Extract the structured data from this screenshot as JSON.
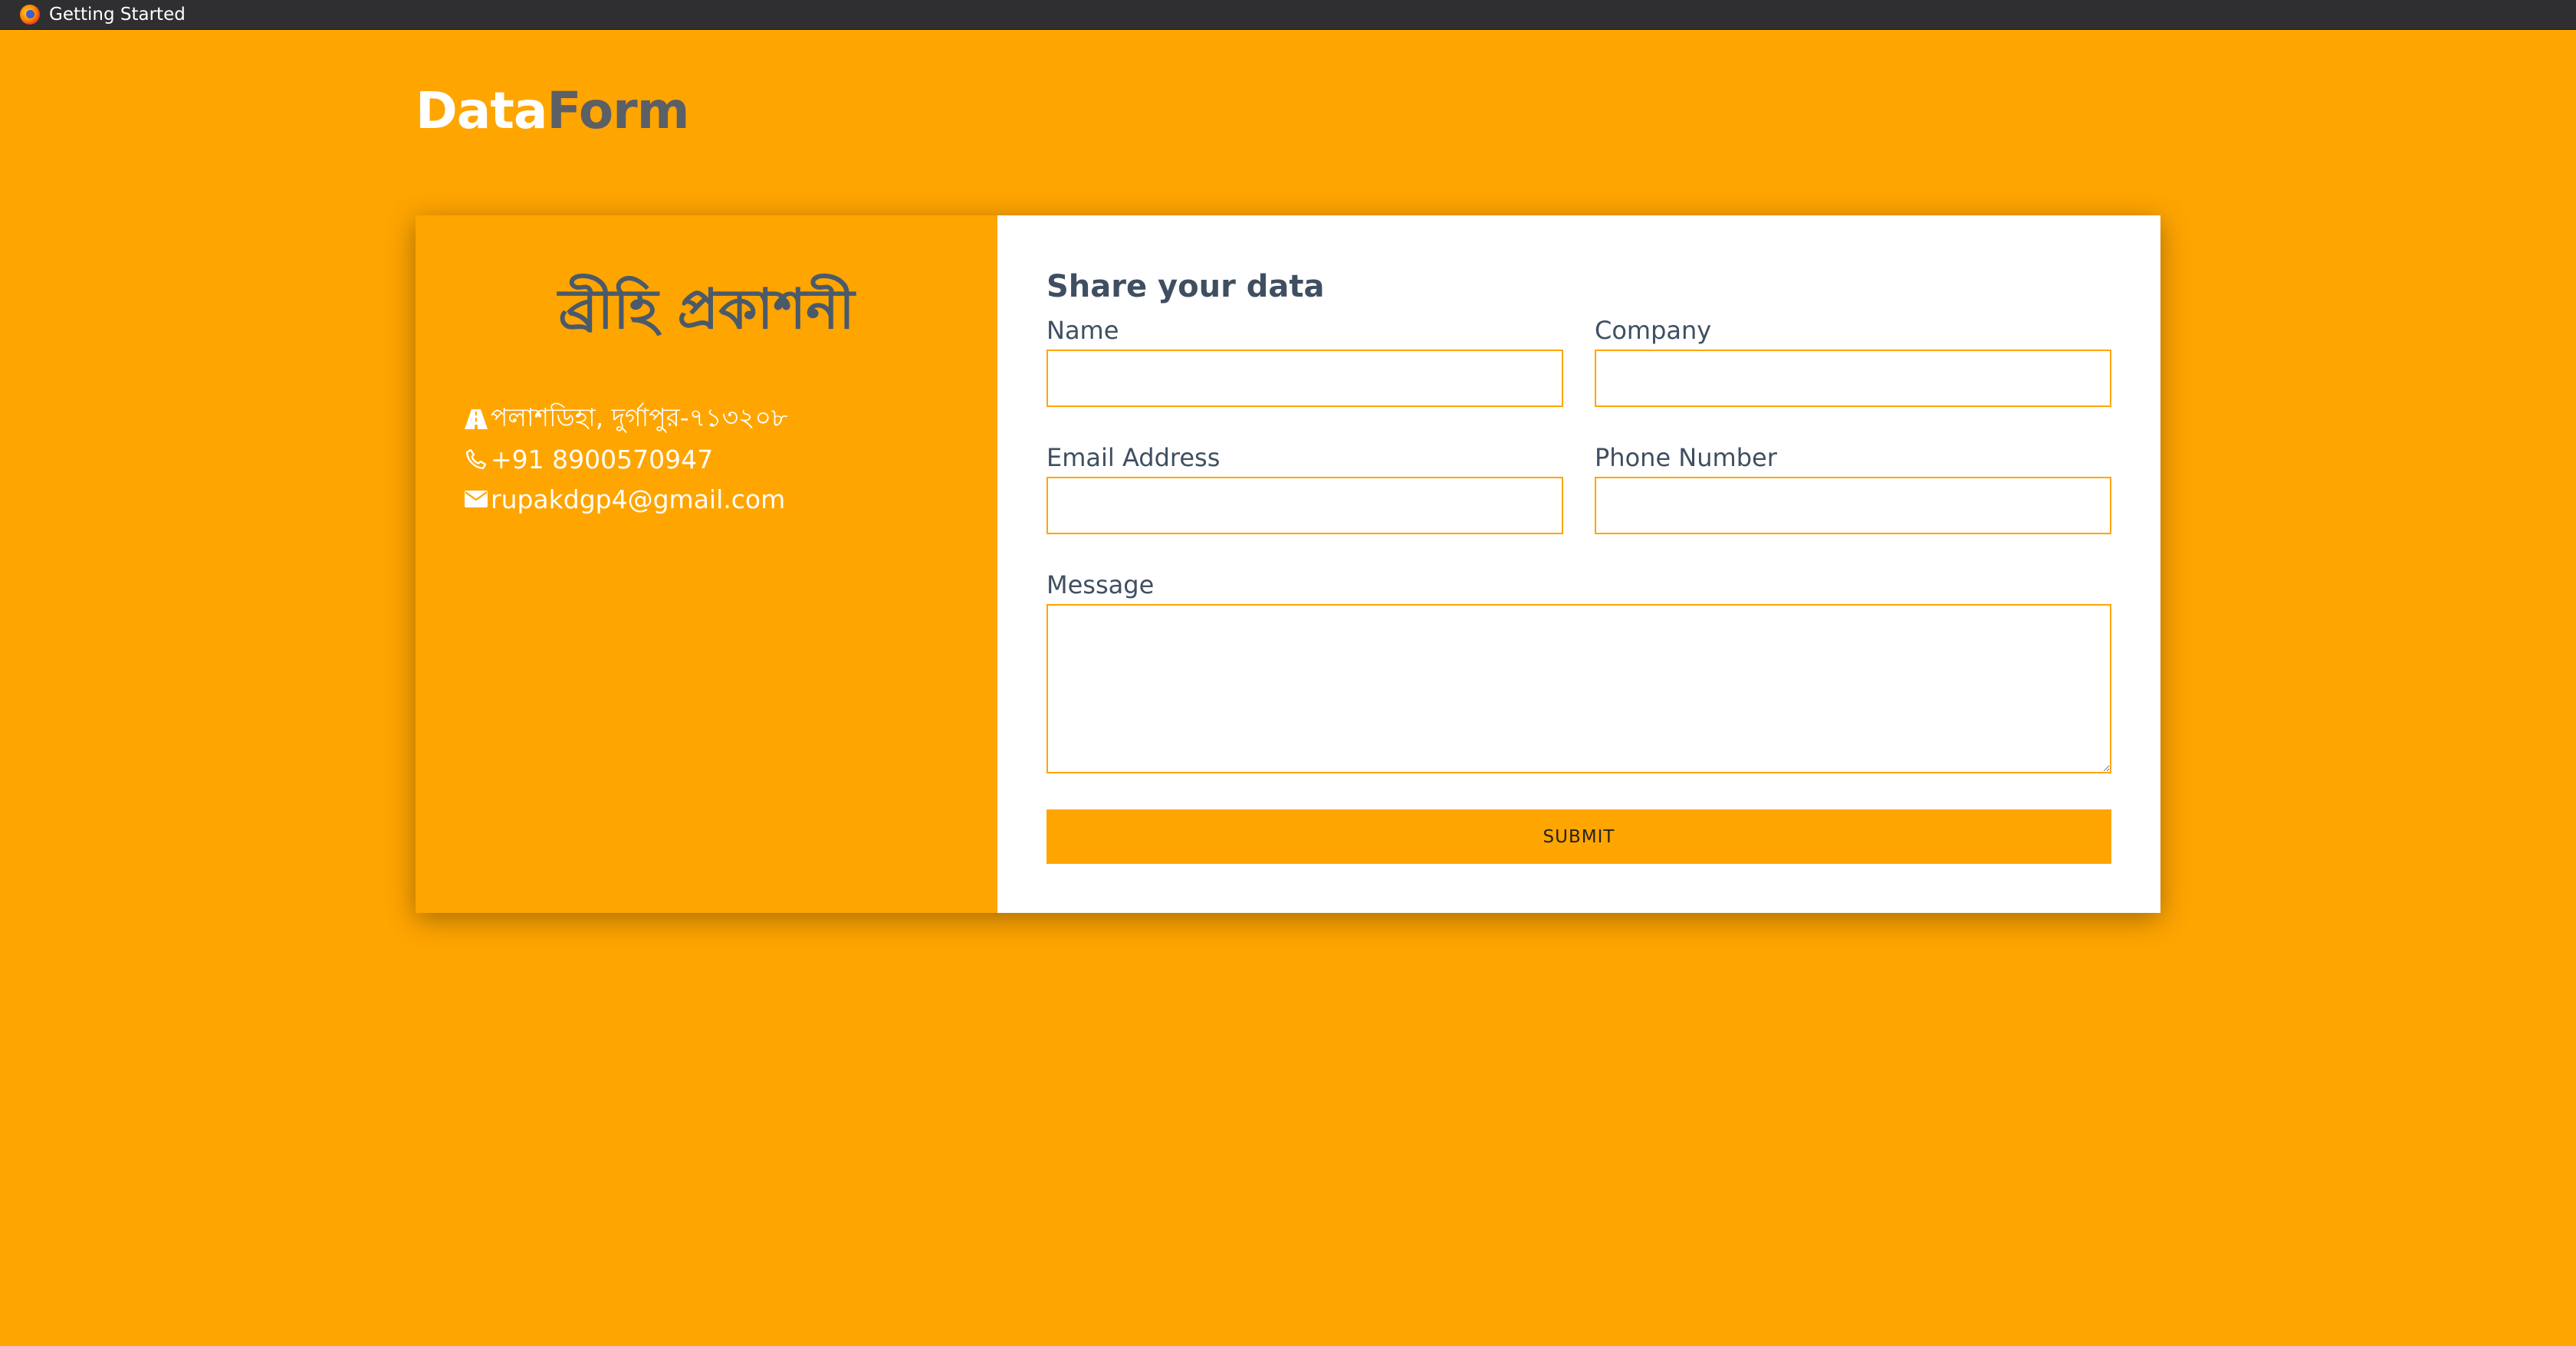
{
  "window": {
    "title": "Getting Started",
    "icon": "firefox-icon"
  },
  "brand": {
    "part1": "Data",
    "part2": "Form"
  },
  "info_panel": {
    "publisher_name": "ব্রীহি প্রকাশনী",
    "address": "পলাশডিহা, দুর্গাপুর-৭১৩২০৮",
    "address_icon": "road-icon",
    "phone": "+91 8900570947",
    "phone_icon": "phone-icon",
    "email": "rupakdgp4@gmail.com",
    "email_icon": "envelope-icon"
  },
  "form": {
    "heading": "Share your data",
    "name_label": "Name",
    "name_value": "",
    "company_label": "Company",
    "company_value": "",
    "email_label": "Email Address",
    "email_value": "",
    "phone_label": "Phone Number",
    "phone_value": "",
    "message_label": "Message",
    "message_value": "",
    "submit_label": "SUBMIT"
  },
  "colors": {
    "background": "#ffa500",
    "accent": "#ffa500",
    "text_dark": "#3f4f61",
    "text_light": "#ffffff",
    "brand_secondary": "#5b5f66"
  }
}
